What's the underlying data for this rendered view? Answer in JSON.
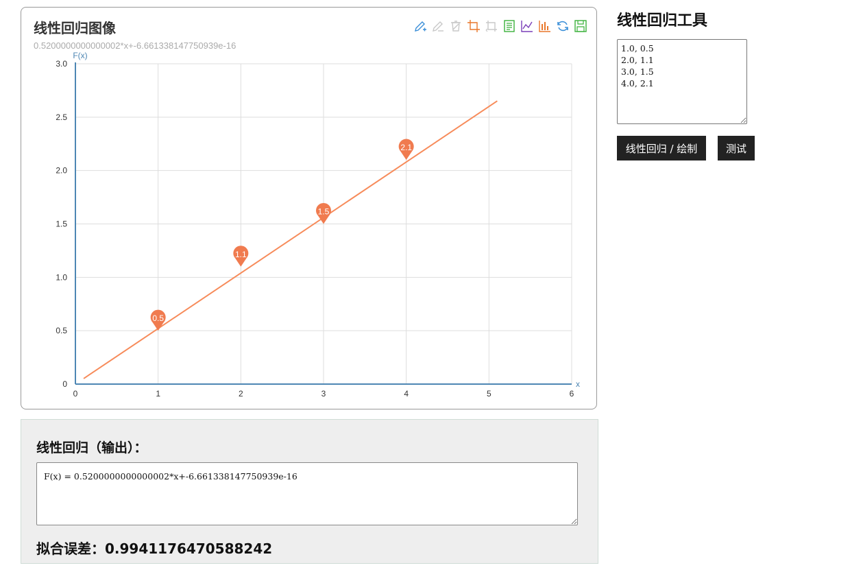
{
  "chart": {
    "title": "线性回归图像",
    "subtitle": "0.5200000000000002*x+-6.661338147750939e-16"
  },
  "toolbox": {
    "icons": [
      "pencil-add-icon",
      "pencil-icon",
      "eraser-icon",
      "crop-icon",
      "restore-icon",
      "data-view-icon",
      "line-chart-icon",
      "bar-chart-icon",
      "refresh-icon",
      "save-icon"
    ],
    "colors": {
      "blue": "#3b8fd8",
      "gray": "#c8c8c8",
      "orange": "#e9772a",
      "green": "#3ab13a",
      "purple": "#7a3fb8"
    }
  },
  "chart_data": {
    "type": "scatter",
    "title": "",
    "xlabel": "x",
    "ylabel": "F(x)",
    "xlim": [
      0,
      6
    ],
    "ylim": [
      0,
      3.0
    ],
    "x_ticks": [
      "0",
      "1",
      "2",
      "3",
      "4",
      "5",
      "6"
    ],
    "y_ticks": [
      "0",
      "0.5",
      "1.0",
      "1.5",
      "2.0",
      "2.5",
      "3.0"
    ],
    "points": [
      {
        "x": 1,
        "y": 0.5,
        "label": "0.5"
      },
      {
        "x": 2,
        "y": 1.1,
        "label": "1.1"
      },
      {
        "x": 3,
        "y": 1.5,
        "label": "1.5"
      },
      {
        "x": 4,
        "y": 2.1,
        "label": "2.1"
      }
    ],
    "regression_line": {
      "slope": 0.5200000000000002,
      "intercept": -6.661338147750939e-16,
      "x_range": [
        0.1,
        5.1
      ]
    },
    "grid": true,
    "colors": {
      "marker": "#f07b4f",
      "line": "#f78b5a",
      "axis": "#4d86b3",
      "grid": "#dddddd"
    }
  },
  "tool_panel": {
    "title": "线性回归工具",
    "data_text": "1.0, 0.5\n2.0, 1.1\n3.0, 1.5\n4.0, 2.1",
    "regress_button": "线性回归 / 绘制",
    "test_button": "测试"
  },
  "output": {
    "title": "线性回归（输出）：",
    "formula": "F(x) = 0.5200000000000002*x+-6.661338147750939e-16",
    "error_label": "拟合误差：",
    "error_value": "0.9941176470588242"
  }
}
